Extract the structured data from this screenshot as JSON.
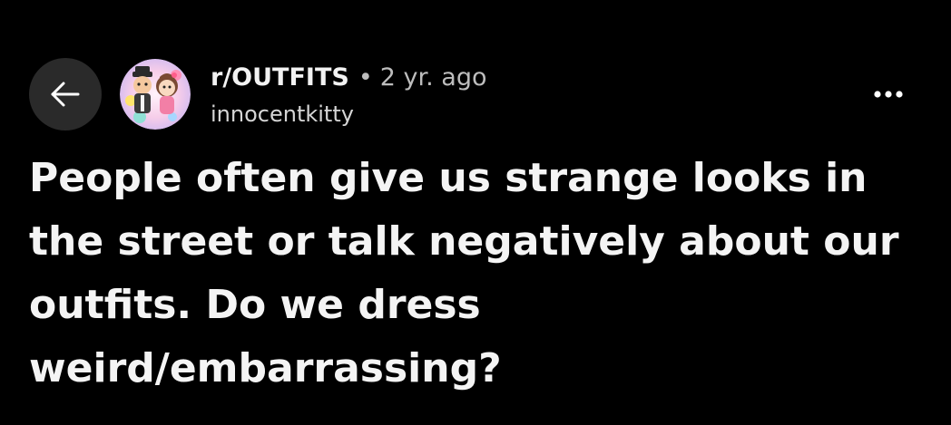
{
  "header": {
    "back_icon": "arrow-left-icon",
    "avatar_icon": "user-avatar",
    "subreddit": "r/OUTFITS",
    "separator": "•",
    "time_ago": "2 yr. ago",
    "username": "innocentkitty",
    "more_icon": "more-dots-icon"
  },
  "post": {
    "title": "People often give us strange looks in the street or talk negatively about our outfits. Do we dress weird/embarrassing?"
  },
  "colors": {
    "background": "#000000",
    "text": "#f2f2f2",
    "muted_text": "#bdbdbd",
    "button_bg": "#2a2a2a"
  }
}
